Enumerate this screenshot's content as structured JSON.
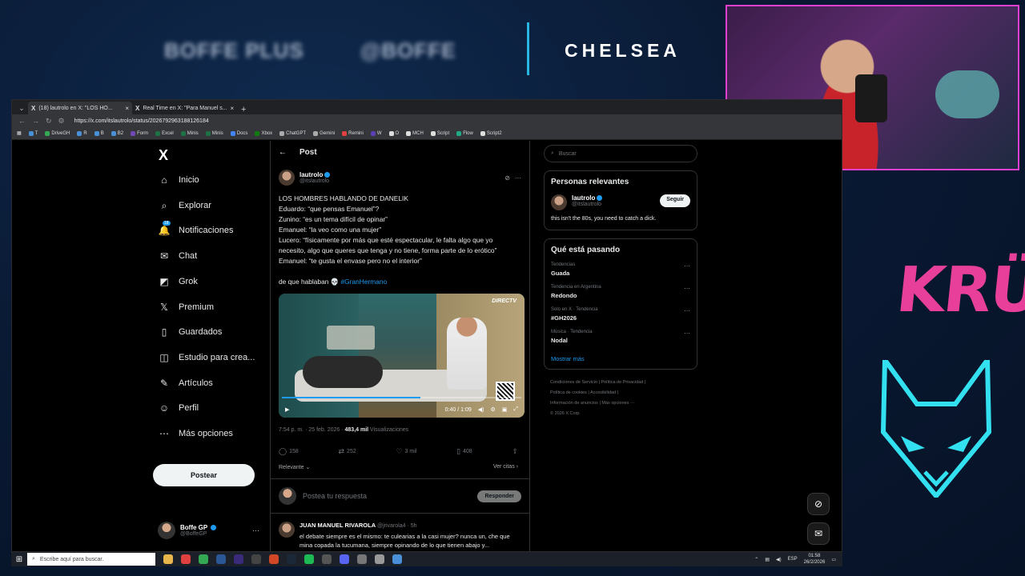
{
  "overlay": {
    "brand1": "BOFFE PLUS",
    "brand2": "@BOFFE",
    "team": "CHELSEA",
    "sponsor_logo": "KRÜ"
  },
  "browser": {
    "tabs": [
      {
        "label": "(18) lautrolo en X: \"LOS HO...",
        "active": true
      },
      {
        "label": "Real Time en X: \"Para Manuel s...",
        "active": false
      }
    ],
    "url": "https://x.com/itslautrolo/status/2026792963188126184",
    "bookmarks": [
      {
        "label": "T",
        "color": "#4a90d9"
      },
      {
        "label": "DriveGH",
        "color": "#34a853"
      },
      {
        "label": "R",
        "color": "#4a90d9"
      },
      {
        "label": "B",
        "color": "#4a90d9"
      },
      {
        "label": "B2",
        "color": "#4a90d9"
      },
      {
        "label": "Form",
        "color": "#7248b9"
      },
      {
        "label": "Excel",
        "color": "#1e7145"
      },
      {
        "label": "Minis",
        "color": "#1e7145"
      },
      {
        "label": "Minis",
        "color": "#1e7145"
      },
      {
        "label": "Docs",
        "color": "#4285f4"
      },
      {
        "label": "Xbox",
        "color": "#107c10"
      },
      {
        "label": "ChatGPT",
        "color": "#aaaaaa"
      },
      {
        "label": "Gemini",
        "color": "#aaaaaa"
      },
      {
        "label": "Remini",
        "color": "#e04040"
      },
      {
        "label": "W",
        "color": "#5b3fb5"
      },
      {
        "label": "O",
        "color": "#dddddd"
      },
      {
        "label": "MCH",
        "color": "#dddddd"
      },
      {
        "label": "Script",
        "color": "#dddddd"
      },
      {
        "label": "Flow",
        "color": "#22aa88"
      },
      {
        "label": "Script2",
        "color": "#dddddd"
      }
    ]
  },
  "nav": {
    "items": [
      {
        "label": "Inicio",
        "icon": "home-icon",
        "glyph": "⌂"
      },
      {
        "label": "Explorar",
        "icon": "search-icon",
        "glyph": "⌕"
      },
      {
        "label": "Notificaciones",
        "icon": "bell-icon",
        "glyph": "🔔",
        "badge": "18"
      },
      {
        "label": "Chat",
        "icon": "mail-icon",
        "glyph": "✉"
      },
      {
        "label": "Grok",
        "icon": "grok-icon",
        "glyph": "◩"
      },
      {
        "label": "Premium",
        "icon": "x-icon",
        "glyph": "𝕏"
      },
      {
        "label": "Guardados",
        "icon": "bookmark-icon",
        "glyph": "▯"
      },
      {
        "label": "Estudio para crea...",
        "icon": "studio-icon",
        "glyph": "◫"
      },
      {
        "label": "Artículos",
        "icon": "article-icon",
        "glyph": "✎"
      },
      {
        "label": "Perfil",
        "icon": "profile-icon",
        "glyph": "☺"
      },
      {
        "label": "Más opciones",
        "icon": "more-icon",
        "glyph": "⋯"
      }
    ],
    "post_button": "Postear",
    "account": {
      "name": "Boffe GP",
      "handle": "@BoffeGP"
    }
  },
  "post": {
    "header_title": "Post",
    "author": {
      "name": "lautrolo",
      "handle": "@itslautrolo"
    },
    "lines": [
      "LOS HOMBRES HABLANDO DE DANELIK",
      "Eduardo: “que pensas Emanuel”?",
      "Zunino: “es un tema difícil de opinar”",
      "Emanuel: “la veo como una mujer”",
      "Lucero: “físicamente por más que esté espectacular, le falta algo que yo necesito, algo que queres que tenga y no tiene, forma parte de lo erótico”",
      "Emanuel: “te gusta el envase pero no el interior”"
    ],
    "closing": "de que hablaban 💀",
    "hashtag": "#GranHermano",
    "video": {
      "channel": "DIRECTV",
      "time": "0:40 / 1:09",
      "progress": 0.58
    },
    "meta": {
      "time": "7:54 p. m. · 25 feb. 2026 ·",
      "views": "483,4 mil",
      "views_label": "Visualizaciones"
    },
    "stats": {
      "replies": "158",
      "reposts": "252",
      "likes": "3 mil",
      "bookmarks": "408"
    },
    "sort_label": "Relevante",
    "quotes_label": "Ver citas",
    "reply_placeholder": "Postea tu respuesta",
    "reply_button": "Responder"
  },
  "reply": {
    "name": "JUAN MANUEL RIVAROLA",
    "handle": "@jrivarola4 · 5h",
    "text": "el debate siempre es el mismo: te culearias a la casi mujer? nunca un, che que mina copada la tucumana, siempre opinando de lo que tienen abajo y..."
  },
  "right": {
    "search_placeholder": "Buscar",
    "relevant_title": "Personas relevantes",
    "person": {
      "name": "lautrolo",
      "handle": "@itslautrolo",
      "bio": "this isn't the 80s, you need to catch a dick.",
      "follow": "Seguir"
    },
    "trends_title": "Qué está pasando",
    "trends": [
      {
        "meta": "Tendencias",
        "name": "Guada"
      },
      {
        "meta": "Tendencia en Argentina",
        "name": "Redondo"
      },
      {
        "meta": "Solo en X · Tendencia",
        "name": "#GH2026"
      },
      {
        "meta": "Música · Tendencia",
        "name": "Nodal"
      }
    ],
    "show_more": "Mostrar más",
    "footer": [
      "Condiciones de Servicio  |  Política de Privacidad  |",
      "Política de cookies  |  Accesibilidad  |",
      "Información de anuncios  |  Más opciones ···",
      "© 2026 X Corp."
    ]
  },
  "taskbar": {
    "search_placeholder": "Escribe aquí para buscar.",
    "lang": "ESP",
    "time": "01:58",
    "date": "26/2/2026",
    "icons": [
      "#e8b64a",
      "#e04040",
      "#34a853",
      "#2b5797",
      "#3a2a7a",
      "#444444",
      "#d24726",
      "#1b2838",
      "#1db954",
      "#555555",
      "#5865f2",
      "#777777",
      "#999999",
      "#4a90d9"
    ]
  }
}
